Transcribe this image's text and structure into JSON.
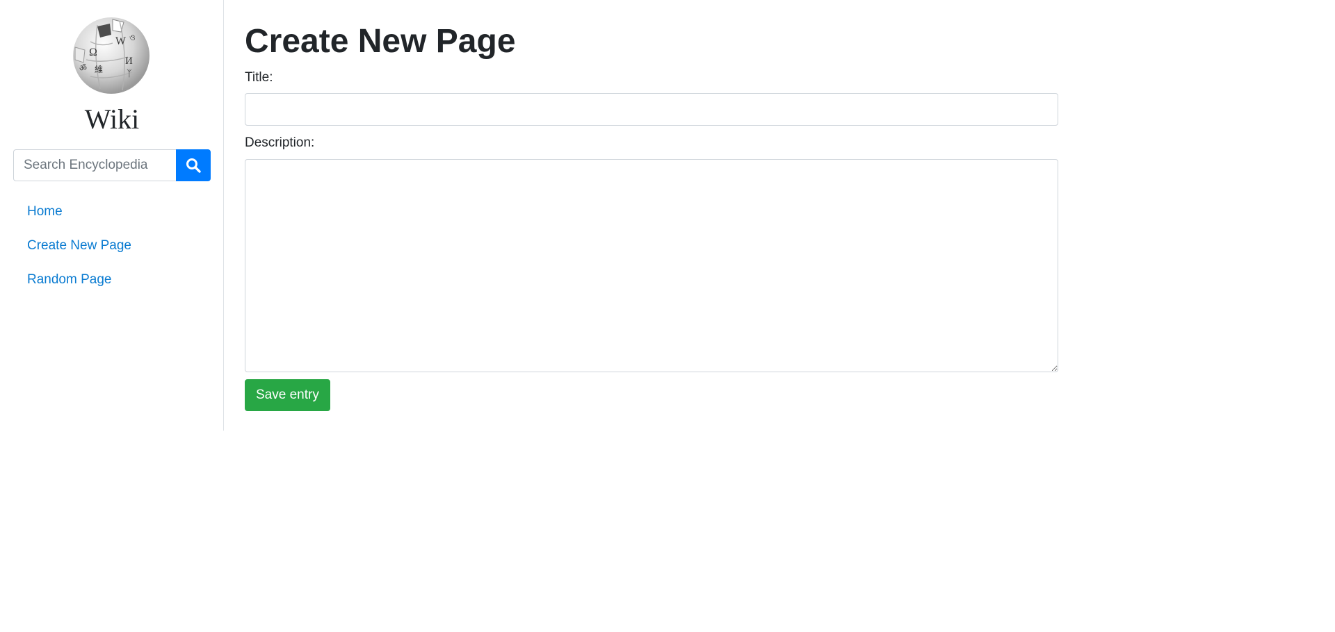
{
  "sidebar": {
    "logo_icon": "wikipedia-globe-icon",
    "site_name": "Wiki",
    "search": {
      "placeholder": "Search Encyclopedia",
      "value": "",
      "button_icon": "search-icon",
      "button_color": "#007bff"
    },
    "nav": [
      {
        "label": "Home"
      },
      {
        "label": "Create New Page"
      },
      {
        "label": "Random Page"
      }
    ],
    "link_color": "#0a7bd1"
  },
  "main": {
    "page_title": "Create New Page",
    "title_label": "Title:",
    "title_value": "",
    "description_label": "Description:",
    "description_value": "",
    "save_label": "Save entry",
    "save_color": "#28a745"
  }
}
